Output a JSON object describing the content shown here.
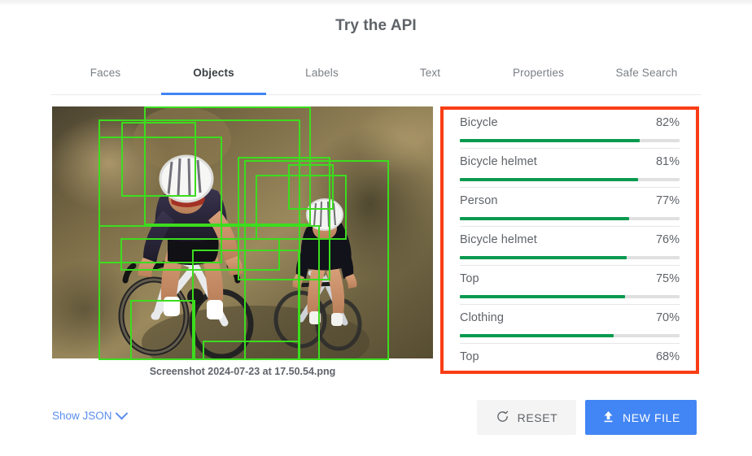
{
  "header": {
    "title": "Try the API"
  },
  "tabs": [
    {
      "label": "Faces",
      "active": false
    },
    {
      "label": "Objects",
      "active": true
    },
    {
      "label": "Labels",
      "active": false
    },
    {
      "label": "Text",
      "active": false
    },
    {
      "label": "Properties",
      "active": false
    },
    {
      "label": "Safe Search",
      "active": false
    }
  ],
  "image": {
    "caption": "Screenshot 2024-07-23 at 17.50.54.png",
    "alt": "Two cyclists riding gravel bikes with green object-detection bounding boxes",
    "box_color": "#3cdd1e"
  },
  "results": {
    "highlight_color": "#f93d15",
    "bar_color": "#089a4f",
    "track_color": "#e0e0e0",
    "items": [
      {
        "label": "Bicycle",
        "percent": "82%",
        "value": 82
      },
      {
        "label": "Bicycle helmet",
        "percent": "81%",
        "value": 81
      },
      {
        "label": "Person",
        "percent": "77%",
        "value": 77
      },
      {
        "label": "Bicycle helmet",
        "percent": "76%",
        "value": 76
      },
      {
        "label": "Top",
        "percent": "75%",
        "value": 75
      },
      {
        "label": "Clothing",
        "percent": "70%",
        "value": 70
      },
      {
        "label": "Top",
        "percent": "68%",
        "value": 68
      }
    ]
  },
  "footer": {
    "show_json_label": "Show JSON",
    "show_json_icon": "chevron-down-icon",
    "reset_label": "RESET",
    "reset_icon": "refresh-icon",
    "new_file_label": "NEW FILE",
    "new_file_icon": "upload-icon",
    "new_file_color": "#4285f4"
  }
}
